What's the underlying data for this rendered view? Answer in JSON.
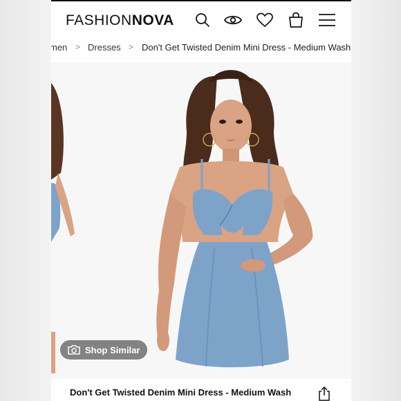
{
  "header": {
    "logo_light": "FASHION",
    "logo_bold": "NOVA",
    "icons": [
      "search-icon",
      "eye-icon",
      "heart-icon",
      "shopping-bag-icon",
      "menu-icon"
    ]
  },
  "breadcrumb": {
    "items": [
      {
        "label": "men"
      },
      {
        "label": "Dresses"
      },
      {
        "label": "Don't Get Twisted Denim Mini Dress - Medium Wash"
      }
    ],
    "separator": ">"
  },
  "product": {
    "shop_similar_label": "Shop Similar",
    "title": "Don't Get Twisted Denim Mini Dress - Medium Wash"
  },
  "colors": {
    "denim": "#7ea3c9",
    "skin": "#d9a384",
    "hair": "#4a2b1c",
    "accent_text": "#111111"
  }
}
